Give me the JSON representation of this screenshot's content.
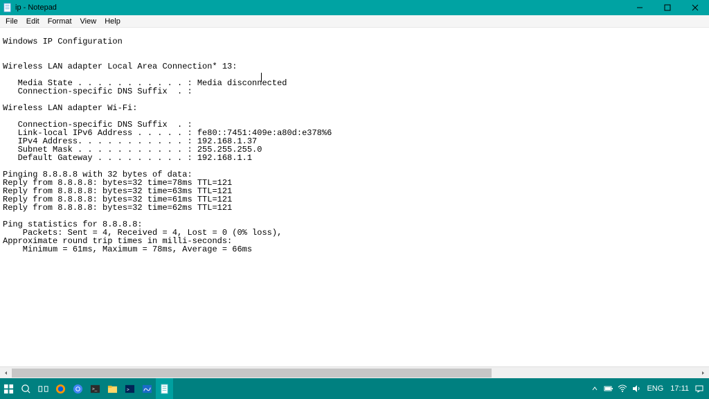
{
  "window": {
    "title": "ip - Notepad"
  },
  "menu": {
    "file": "File",
    "edit": "Edit",
    "format": "Format",
    "view": "View",
    "help": "Help"
  },
  "content": {
    "lines": [
      "",
      "Windows IP Configuration",
      "",
      "",
      "Wireless LAN adapter Local Area Connection* 13:",
      "",
      "   Media State . . . . . . . . . . . : Media disconnected",
      "   Connection-specific DNS Suffix  . :",
      "",
      "Wireless LAN adapter Wi-Fi:",
      "",
      "   Connection-specific DNS Suffix  . :",
      "   Link-local IPv6 Address . . . . . : fe80::7451:409e:a80d:e378%6",
      "   IPv4 Address. . . . . . . . . . . : 192.168.1.37",
      "   Subnet Mask . . . . . . . . . . . : 255.255.255.0",
      "   Default Gateway . . . . . . . . . : 192.168.1.1",
      "",
      "Pinging 8.8.8.8 with 32 bytes of data:",
      "Reply from 8.8.8.8: bytes=32 time=78ms TTL=121",
      "Reply from 8.8.8.8: bytes=32 time=63ms TTL=121",
      "Reply from 8.8.8.8: bytes=32 time=61ms TTL=121",
      "Reply from 8.8.8.8: bytes=32 time=62ms TTL=121",
      "",
      "Ping statistics for 8.8.8.8:",
      "    Packets: Sent = 4, Received = 4, Lost = 0 (0% loss),",
      "Approximate round trip times in milli-seconds:",
      "    Minimum = 61ms, Maximum = 78ms, Average = 66ms"
    ]
  },
  "taskbar": {
    "lang": "ENG",
    "time": "17:11"
  }
}
